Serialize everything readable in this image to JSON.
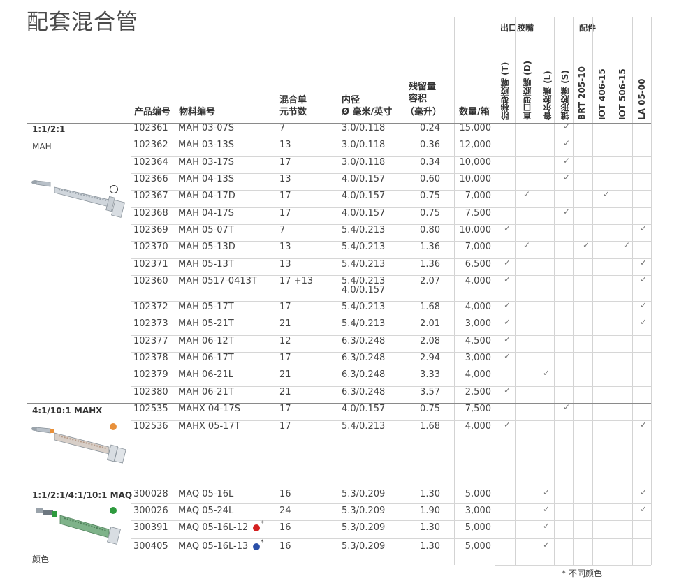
{
  "title": "配套混合管",
  "headers": {
    "part_no": "产品编号",
    "material_no": "物料编号",
    "elements_1": "混合单",
    "elements_2": "元节数",
    "diameter_1": "内径",
    "diameter_2": "Ø 毫米/英寸",
    "retention_1": "残留量",
    "retention_2": "容积",
    "retention_3": "（毫升）",
    "qty": "数量/箱",
    "group_outlet": "出口胶嘴",
    "group_acc": "配件",
    "tip_t": "阶梯型胶嘴 (T)",
    "tip_d": "直口型胶嘴 (D)",
    "tip_l": "鲁尔胶嘴 (L)",
    "tip_s": "锥形胶嘴 (S)",
    "acc_brt": "BRT 205-10",
    "acc_iot406": "IOT 406-15",
    "acc_iot506": "IOT 506-15",
    "acc_la": "LA 05-00"
  },
  "check_symbol": "✓",
  "sections": [
    {
      "label": "1:1/2:1",
      "sub": "MAH",
      "dot_color": "#ffffff"
    },
    {
      "label": "4:1/10:1 MAHX",
      "sub": "",
      "dot_color": "#e8903a"
    },
    {
      "label": "1:1/2:1/4:1/10:1 MAQ",
      "sub": "颜色",
      "dot_color": "#2e9a3e"
    }
  ],
  "rows": [
    {
      "part": "102361",
      "mat": "MAH 03-07S",
      "el": "7",
      "dia": "3.0/0.118",
      "vol": "0.24",
      "qty": "15,000",
      "checks": [
        3
      ]
    },
    {
      "part": "102362",
      "mat": "MAH 03-13S",
      "el": "13",
      "dia": "3.0/0.118",
      "vol": "0.36",
      "qty": "12,000",
      "checks": [
        3
      ]
    },
    {
      "part": "102364",
      "mat": "MAH 03-17S",
      "el": "17",
      "dia": "3.0/0.118",
      "vol": "0.34",
      "qty": "10,000",
      "checks": [
        3
      ]
    },
    {
      "part": "102366",
      "mat": "MAH 04-13S",
      "el": "13",
      "dia": "4.0/0.157",
      "vol": "0.60",
      "qty": "10,000",
      "checks": [
        3
      ]
    },
    {
      "part": "102367",
      "mat": "MAH 04-17D",
      "el": "17",
      "dia": "4.0/0.157",
      "vol": "0.75",
      "qty": "7,000",
      "checks": [
        1,
        5
      ]
    },
    {
      "part": "102368",
      "mat": "MAH 04-17S",
      "el": "17",
      "dia": "4.0/0.157",
      "vol": "0.75",
      "qty": "7,500",
      "checks": [
        3
      ]
    },
    {
      "part": "102369",
      "mat": "MAH 05-07T",
      "el": "7",
      "dia": "5.4/0.213",
      "vol": "0.80",
      "qty": "10,000",
      "checks": [
        0,
        7
      ]
    },
    {
      "part": "102370",
      "mat": "MAH 05-13D",
      "el": "13",
      "dia": "5.4/0.213",
      "vol": "1.36",
      "qty": "7,000",
      "checks": [
        1,
        4,
        6
      ]
    },
    {
      "part": "102371",
      "mat": "MAH 05-13T",
      "el": "13",
      "dia": "5.4/0.213",
      "vol": "1.36",
      "qty": "6,500",
      "checks": [
        0,
        7
      ]
    },
    {
      "part": "102360",
      "mat": "MAH 0517-0413T",
      "el": "17 +13",
      "dia": "5.4/0.213",
      "dia2": "4.0/0.157",
      "vol": "2.07",
      "qty": "4,000",
      "checks": [
        0,
        7
      ]
    },
    {
      "part": "102372",
      "mat": "MAH 05-17T",
      "el": "17",
      "dia": "5.4/0.213",
      "vol": "1.68",
      "qty": "4,000",
      "checks": [
        0,
        7
      ]
    },
    {
      "part": "102373",
      "mat": "MAH 05-21T",
      "el": "21",
      "dia": "5.4/0.213",
      "vol": "2.01",
      "qty": "3,000",
      "checks": [
        0,
        7
      ]
    },
    {
      "part": "102377",
      "mat": "MAH 06-12T",
      "el": "12",
      "dia": "6.3/0.248",
      "vol": "2.08",
      "qty": "4,500",
      "checks": [
        0
      ]
    },
    {
      "part": "102378",
      "mat": "MAH 06-17T",
      "el": "17",
      "dia": "6.3/0.248",
      "vol": "2.94",
      "qty": "3,000",
      "checks": [
        0
      ]
    },
    {
      "part": "102379",
      "mat": "MAH 06-21L",
      "el": "21",
      "dia": "6.3/0.248",
      "vol": "3.33",
      "qty": "4,000",
      "checks": [
        2
      ]
    },
    {
      "part": "102380",
      "mat": "MAH 06-21T",
      "el": "21",
      "dia": "6.3/0.248",
      "vol": "3.57",
      "qty": "2,500",
      "checks": [
        0
      ]
    },
    {
      "part": "102535",
      "mat": "MAHX 04-17S",
      "el": "17",
      "dia": "4.0/0.157",
      "vol": "0.75",
      "qty": "7,500",
      "checks": [
        3
      ]
    },
    {
      "part": "102536",
      "mat": "MAHX 05-17T",
      "el": "17",
      "dia": "5.4/0.213",
      "vol": "1.68",
      "qty": "4,000",
      "checks": [
        0,
        7
      ]
    },
    {
      "part": "300028",
      "mat": "MAQ 05-16L",
      "el": "16",
      "dia": "5.3/0.209",
      "vol": "1.30",
      "qty": "5,000",
      "checks": [
        2,
        7
      ]
    },
    {
      "part": "300026",
      "mat": "MAQ 05-24L",
      "el": "24",
      "dia": "5.3/0.209",
      "vol": "1.90",
      "qty": "3,000",
      "checks": [
        2,
        7
      ]
    },
    {
      "part": "300391",
      "mat": "MAQ 05-16L-12",
      "el": "16",
      "dia": "5.3/0.209",
      "vol": "1.30",
      "qty": "5,000",
      "checks": [
        2
      ],
      "color_dot": "#d42020"
    },
    {
      "part": "300405",
      "mat": "MAQ 05-16L-13",
      "el": "16",
      "dia": "5.3/0.209",
      "vol": "1.30",
      "qty": "5,000",
      "checks": [
        2
      ],
      "color_dot": "#2a4fa8"
    }
  ],
  "asterisk": "*",
  "footnote": "* 不同颜色"
}
